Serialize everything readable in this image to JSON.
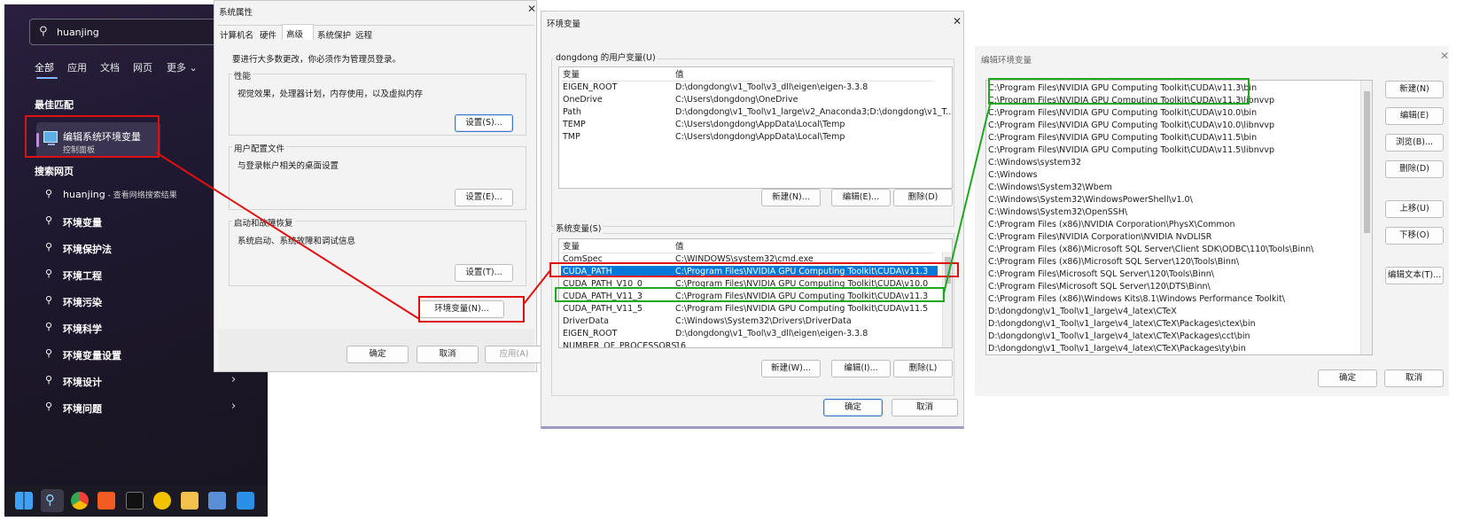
{
  "start_menu": {
    "search_value": "huanjing",
    "categories": [
      "全部",
      "应用",
      "文档",
      "网页",
      "更多"
    ],
    "best_match_title": "最佳匹配",
    "best_match": {
      "title": "编辑系统环境变量",
      "subtitle": "控制面板"
    },
    "web_title": "搜索网页",
    "web_first": {
      "term": "huanjing",
      "suffix": " - 查看网络搜索结果"
    },
    "web_items": [
      "环境变量",
      "环境保护法",
      "环境工程",
      "环境污染",
      "环境科学",
      "环境变量设置",
      "环境设计",
      "环境问题"
    ]
  },
  "sysprops": {
    "title": "系统属性",
    "tabs": [
      "计算机名",
      "硬件",
      "高级",
      "系统保护",
      "远程"
    ],
    "admin_note": "要进行大多数更改，你必须作为管理员登录。",
    "perf": {
      "title": "性能",
      "desc": "视觉效果，处理器计划，内存使用，以及虚拟内存",
      "button": "设置(S)..."
    },
    "profile": {
      "title": "用户配置文件",
      "desc": "与登录帐户相关的桌面设置",
      "button": "设置(E)..."
    },
    "startup": {
      "title": "启动和故障恢复",
      "desc": "系统启动、系统故障和调试信息",
      "button": "设置(T)..."
    },
    "env_button": "环境变量(N)...",
    "ok": "确定",
    "cancel": "取消",
    "apply": "应用(A)"
  },
  "envvars": {
    "title": "环境变量",
    "user_group": "dongdong 的用户变量(U)",
    "col_var": "变量",
    "col_val": "值",
    "user_vars": [
      {
        "name": "EIGEN_ROOT",
        "value": "D:\\dongdong\\v1_Tool\\v3_dll\\eigen\\eigen-3.3.8"
      },
      {
        "name": "OneDrive",
        "value": "C:\\Users\\dongdong\\OneDrive"
      },
      {
        "name": "Path",
        "value": "D:\\dongdong\\v1_Tool\\v1_large\\v2_Anaconda3;D:\\dongdong\\v1_T..."
      },
      {
        "name": "TEMP",
        "value": "C:\\Users\\dongdong\\AppData\\Local\\Temp"
      },
      {
        "name": "TMP",
        "value": "C:\\Users\\dongdong\\AppData\\Local\\Temp"
      }
    ],
    "user_buttons": [
      "新建(N)...",
      "编辑(E)...",
      "删除(D)"
    ],
    "sys_group": "系统变量(S)",
    "sys_vars": [
      {
        "name": "ComSpec",
        "value": "C:\\WINDOWS\\system32\\cmd.exe"
      },
      {
        "name": "CUDA_PATH",
        "value": "C:\\Program Files\\NVIDIA GPU Computing Toolkit\\CUDA\\v11.3"
      },
      {
        "name": "CUDA_PATH_V10_0",
        "value": "C:\\Program Files\\NVIDIA GPU Computing Toolkit\\CUDA\\v10.0"
      },
      {
        "name": "CUDA_PATH_V11_3",
        "value": "C:\\Program Files\\NVIDIA GPU Computing Toolkit\\CUDA\\v11.3"
      },
      {
        "name": "CUDA_PATH_V11_5",
        "value": "C:\\Program Files\\NVIDIA GPU Computing Toolkit\\CUDA\\v11.5"
      },
      {
        "name": "DriverData",
        "value": "C:\\Windows\\System32\\Drivers\\DriverData"
      },
      {
        "name": "EIGEN_ROOT",
        "value": "D:\\dongdong\\v1_Tool\\v3_dll\\eigen\\eigen-3.3.8"
      },
      {
        "name": "NUMBER_OF_PROCESSORS",
        "value": "16"
      }
    ],
    "sys_buttons": [
      "新建(W)...",
      "编辑(I)...",
      "删除(L)"
    ],
    "ok": "确定",
    "cancel": "取消"
  },
  "editenv": {
    "title": "编辑环境变量",
    "entries": [
      "C:\\Program Files\\NVIDIA GPU Computing Toolkit\\CUDA\\v11.3\\bin",
      "C:\\Program Files\\NVIDIA GPU Computing Toolkit\\CUDA\\v11.3\\libnvvp",
      "C:\\Program Files\\NVIDIA GPU Computing Toolkit\\CUDA\\v10.0\\bin",
      "C:\\Program Files\\NVIDIA GPU Computing Toolkit\\CUDA\\v10.0\\libnvvp",
      "C:\\Program Files\\NVIDIA GPU Computing Toolkit\\CUDA\\v11.5\\bin",
      "C:\\Program Files\\NVIDIA GPU Computing Toolkit\\CUDA\\v11.5\\libnvvp",
      "C:\\Windows\\system32",
      "C:\\Windows",
      "C:\\Windows\\System32\\Wbem",
      "C:\\Windows\\System32\\WindowsPowerShell\\v1.0\\",
      "C:\\Windows\\System32\\OpenSSH\\",
      "C:\\Program Files (x86)\\NVIDIA Corporation\\PhysX\\Common",
      "C:\\Program Files\\NVIDIA Corporation\\NVIDIA NvDLISR",
      "C:\\Program Files (x86)\\Microsoft SQL Server\\Client SDK\\ODBC\\110\\Tools\\Binn\\",
      "C:\\Program Files (x86)\\Microsoft SQL Server\\120\\Tools\\Binn\\",
      "C:\\Program Files\\Microsoft SQL Server\\120\\Tools\\Binn\\",
      "C:\\Program Files\\Microsoft SQL Server\\120\\DTS\\Binn\\",
      "C:\\Program Files (x86)\\Windows Kits\\8.1\\Windows Performance Toolkit\\",
      "D:\\dongdong\\v1_Tool\\v1_large\\v4_latex\\CTeX",
      "D:\\dongdong\\v1_Tool\\v1_large\\v4_latex\\CTeX\\Packages\\ctex\\bin",
      "D:\\dongdong\\v1_Tool\\v1_large\\v4_latex\\CTeX\\Packages\\cct\\bin",
      "D:\\dongdong\\v1_Tool\\v1_large\\v4_latex\\CTeX\\Packages\\ty\\bin"
    ],
    "buttons": [
      "新建(N)",
      "编辑(E)",
      "浏览(B)...",
      "删除(D)",
      "上移(U)",
      "下移(O)",
      "编辑文本(T)..."
    ],
    "ok": "确定",
    "cancel": "取消"
  },
  "colors": {
    "highlight_red": "#e01010",
    "highlight_green": "#1fa81f",
    "selection": "#0078d7"
  },
  "taskbar_icons": [
    "windows-start-icon",
    "search-icon",
    "chrome-icon",
    "browser-icon",
    "terminal-icon",
    "app-icon",
    "folder-icon",
    "photos-icon",
    "vscode-icon"
  ]
}
